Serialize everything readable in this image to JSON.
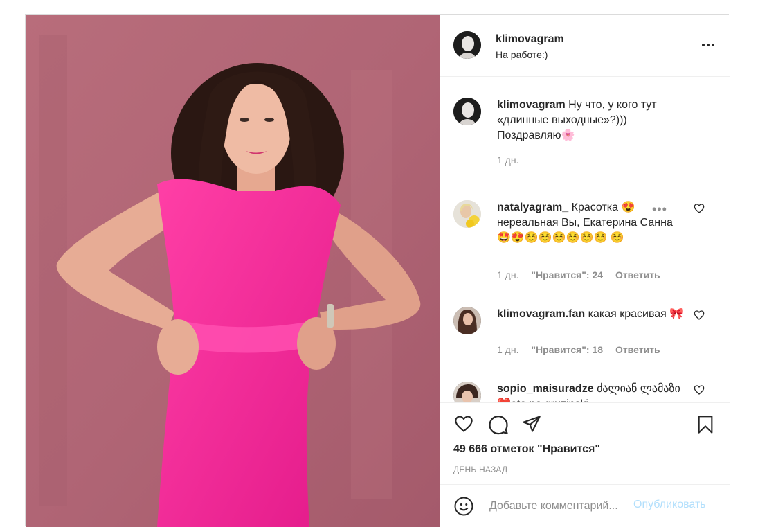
{
  "post": {
    "author": "klimovagram",
    "location": "На работе:)",
    "caption": {
      "username": "klimovagram",
      "text": "Ну что, у кого тут «длинные выходные»?))) Поздравляю🌸",
      "time": "1 дн."
    },
    "comments": [
      {
        "username": "natalyagram_",
        "text": "Красотка 😍 нереальная Вы, Екатерина Санна 🤩😍☺️☺️☺️☺️☺️☺️ ☺️",
        "time": "1 дн.",
        "likes": "\"Нравится\": 24",
        "reply": "Ответить",
        "more": "•••"
      },
      {
        "username": "klimovagram.fan",
        "text": "какая красивая 🎀",
        "time": "1 дн.",
        "likes": "\"Нравится\": 18",
        "reply": "Ответить"
      },
      {
        "username": "sopio_maisuradze",
        "text": "ძალიან ლამაზი❤️eto po gruzinski"
      }
    ],
    "like_count": "49 666 отметок \"Нравится\"",
    "timestamp": "День назад",
    "add_comment": {
      "placeholder": "Добавьте комментарий...",
      "publish": "Опубликовать"
    },
    "icons": {
      "more": "more-options-icon",
      "like": "heart-icon",
      "comment": "comment-icon",
      "share": "share-icon",
      "save": "bookmark-icon",
      "emoji": "emoji-icon"
    },
    "colors": {
      "publish": "#b2dffc",
      "muted": "#8e8e8e",
      "text": "#262626"
    }
  }
}
